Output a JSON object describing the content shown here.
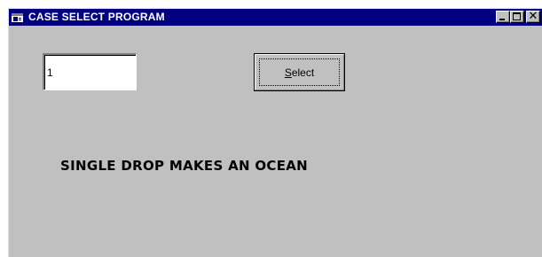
{
  "window": {
    "title": "CASE SELECT PROGRAM",
    "icon": "app-window-icon",
    "controls": {
      "minimize_icon": "minimize-icon",
      "maximize_icon": "maximize-icon",
      "close_glyph": "✕"
    }
  },
  "input": {
    "value": "1"
  },
  "select_button": {
    "label": "Select",
    "mnemonic": "S"
  },
  "message": {
    "text": "SINGLE DROP MAKES AN OCEAN"
  },
  "colors": {
    "titlebar": "#000080",
    "face": "#c0c0c0",
    "text": "#000000"
  }
}
